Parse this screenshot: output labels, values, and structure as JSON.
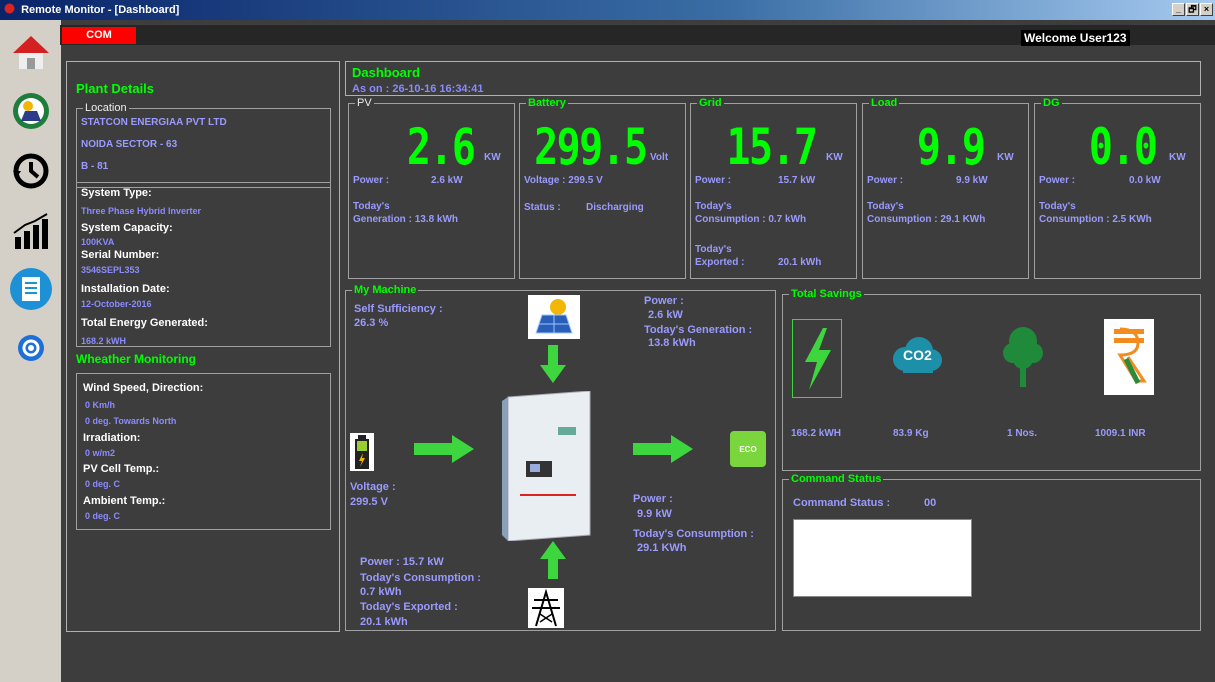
{
  "window": {
    "title": "Remote Monitor - [Dashboard]",
    "minimize": "_",
    "restore": "🗗",
    "close": "×"
  },
  "topbar": {
    "com": "COM",
    "welcome": "Welcome User123"
  },
  "sidebar": [
    {
      "icon": "home-icon"
    },
    {
      "icon": "solar-settings-icon"
    },
    {
      "icon": "history-icon"
    },
    {
      "icon": "chart-icon"
    },
    {
      "icon": "document-icon"
    },
    {
      "icon": "settings-icon"
    }
  ],
  "plant": {
    "title": "Plant Details",
    "location_label": "Location",
    "location": [
      "STATCON ENERGIAA PVT LTD",
      "NOIDA SECTOR - 63",
      "B - 81"
    ],
    "system_type_label": "System Type:",
    "system_type": "Three Phase Hybrid Inverter",
    "capacity_label": "System Capacity:",
    "capacity": "100KVA",
    "serial_label": "Serial Number:",
    "serial": "3546SEPL353",
    "install_label": "Installation Date:",
    "install": "12-October-2016",
    "energy_label": "Total Energy Generated:",
    "energy": "168.2 kWH"
  },
  "weather": {
    "title": "Wheather Monitoring",
    "wind_label": "Wind Speed, Direction:",
    "wind_speed": "0 Km/h",
    "wind_dir": "0 deg. Towards North",
    "irr_label": "Irradiation:",
    "irr": "0 w/m2",
    "pv_temp_label": "PV Cell Temp.:",
    "pv_temp": "0 deg. C",
    "amb_label": "Ambient Temp.:",
    "amb": "0 deg. C"
  },
  "dashboard": {
    "title": "Dashboard",
    "as_on": "As on : 26-10-16 16:34:41",
    "pv": {
      "legend": "PV",
      "value": "2.6",
      "unit": "KW",
      "power_label": "Power :",
      "power": "2.6 kW",
      "gen_label1": "Today's",
      "gen_label2": "Generation :",
      "gen": "13.8 kWh"
    },
    "battery": {
      "legend": "Battery",
      "value": "299.5",
      "unit": "Volt",
      "voltage_label": "Voltage :",
      "voltage": "299.5 V",
      "status_label": "Status :",
      "status": "Discharging"
    },
    "grid": {
      "legend": "Grid",
      "value": "15.7",
      "unit": "KW",
      "power_label": "Power :",
      "power": "15.7 kW",
      "cons_label1": "Today's",
      "cons_label2": "Consumption :",
      "cons": "0.7 kWh",
      "exp_label1": "Today's",
      "exp_label2": "Exported :",
      "exp": "20.1 kWh"
    },
    "load": {
      "legend": "Load",
      "value": "9.9",
      "unit": "KW",
      "power_label": "Power :",
      "power": "9.9 kW",
      "cons_label1": "Today's",
      "cons_label2": "Consumption :",
      "cons": "29.1 KWh"
    },
    "dg": {
      "legend": "DG",
      "value": "0.0",
      "unit": "KW",
      "power_label": "Power :",
      "power": "0.0 kW",
      "cons_label1": "Today's",
      "cons_label2": "Consumption :",
      "cons": "2.5 KWh"
    }
  },
  "machine": {
    "legend": "My Machine",
    "self_label": "Self Sufficiency :",
    "self": "26.3 %",
    "pv_power_label": "Power :",
    "pv_power": "2.6 kW",
    "pv_gen_label": "Today's Generation :",
    "pv_gen": "13.8 kWh",
    "bat_label": "Voltage :",
    "bat": "299.5 V",
    "load_power_label": "Power :",
    "load_power": "9.9 kW",
    "load_cons_label": "Today's Consumption :",
    "load_cons": "29.1 KWh",
    "grid_power": "Power : 15.7 kW",
    "grid_cons_label": "Today's Consumption :",
    "grid_cons": "0.7 kWh",
    "grid_exp_label": "Today's Exported :",
    "grid_exp": "20.1 kWh",
    "eco": "ECO"
  },
  "savings": {
    "legend": "Total Savings",
    "energy": "168.2 kWH",
    "co2": "83.9 Kg",
    "co2_icon": "CO2",
    "trees": "1 Nos.",
    "money": "1009.1 INR"
  },
  "command": {
    "legend": "Command Status",
    "label": "Command Status :",
    "value": "00"
  }
}
